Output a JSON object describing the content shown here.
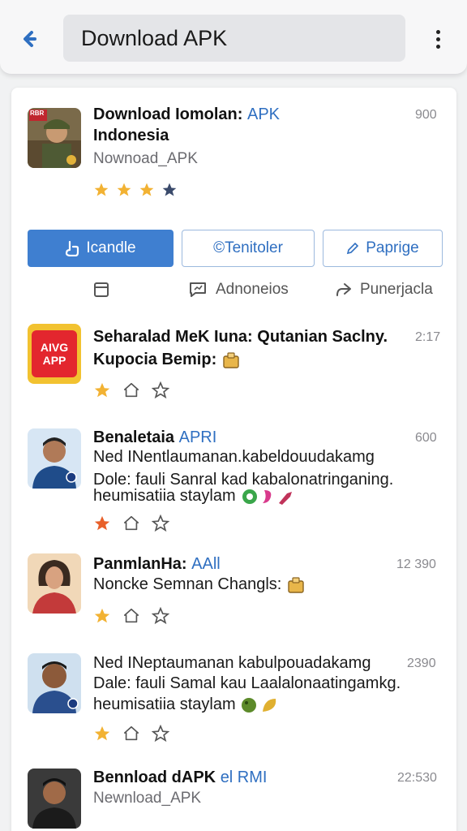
{
  "topbar": {
    "search_text": "Download APK",
    "back_icon": "back-arrow-icon",
    "menu_icon": "more-vertical-icon"
  },
  "featured": {
    "title_line1": "Download Iomolan:",
    "title_accent": "APK",
    "title_line2": "Indonesia",
    "subtitle": "Nownoad_APK",
    "count": "900",
    "rating": 3,
    "thumb_text": "RBR"
  },
  "buttons": {
    "primary": "Icandle",
    "secondary": "©Tenitoler",
    "tertiary": "Paprige"
  },
  "actions": {
    "left": "",
    "middle": "Adnoneios",
    "right": "Punerjacla"
  },
  "items": [
    {
      "title_line1": "Seharalad MeK Iuna: Qutanian Saclny.",
      "title_line2": "Kupocia Bemip:",
      "count": "2:17",
      "thumb_text": "AIVGAPP"
    },
    {
      "title": "Benaletaia",
      "title_accent": "APRI",
      "line1": "Ned INentlaumanan.kabeldouudakamg",
      "line2": "Dole: fauli Sanral kad kabalonatringaning.",
      "line3": "heumisatiia staylam",
      "count": "600"
    },
    {
      "title": "PanmlanHa:",
      "title_accent": "AAll",
      "line1": "Noncke Semnan Changls:",
      "count": "12 390"
    },
    {
      "line1": "Ned INeptaumanan kabulpouadakamg",
      "line2": "Dale: fauli Samal kau Laalalonaatingamkg.",
      "line3": "heumisatiia staylam",
      "count": "2390"
    },
    {
      "title": "Bennload dAPK",
      "title_accent": "el RMI",
      "subtitle": "Newnload_APK",
      "count": "22:530"
    }
  ],
  "colors": {
    "accent": "#2f6fc1",
    "primary_button": "#3f7fd0",
    "star_gold": "#f2b233",
    "star_dark": "#3a4a6b"
  }
}
